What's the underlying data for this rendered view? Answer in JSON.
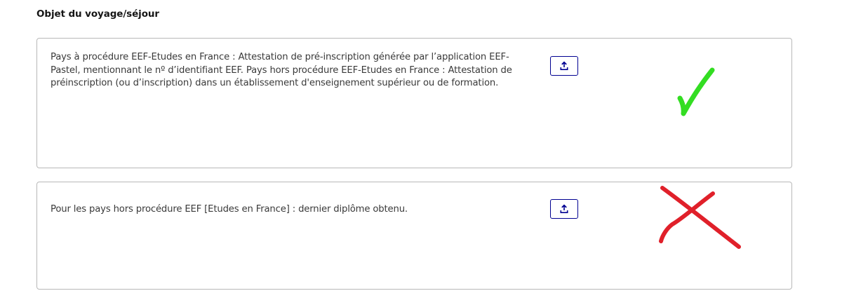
{
  "section": {
    "title": "Objet du voyage/séjour"
  },
  "documents": [
    {
      "text": "Pays à procédure EEF-Etudes en France : Attestation de pré-inscription générée par l’application EEF-Pastel, mentionnant le nº d’identifiant EEF. Pays hors procédure EEF-Etudes en France : Attestation de préinscription (ou d’inscription) dans un établissement d'enseignement supérieur ou de formation.",
      "upload_icon": "upload-icon",
      "annotation": "checkmark",
      "annotation_color": "#33dd22"
    },
    {
      "text": "Pour les pays hors procédure EEF [Etudes en France] : dernier diplôme obtenu.",
      "upload_icon": "upload-icon",
      "annotation": "cross",
      "annotation_color": "#e0202a"
    }
  ],
  "colors": {
    "accent": "#000091",
    "border": "#b8b8b8",
    "text": "#3a3a3a"
  }
}
